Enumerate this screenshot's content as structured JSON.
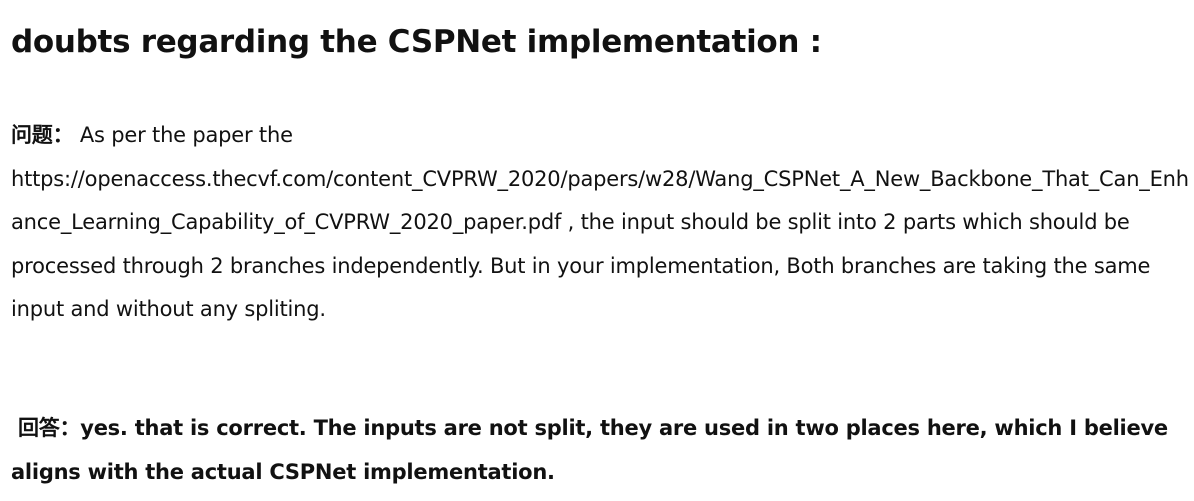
{
  "title": "doubts regarding the CSPNet implementation :",
  "question": {
    "label": "问题：",
    "text_before_link": "As per the paper the",
    "link": "https://openaccess.thecvf.com/content_CVPRW_2020/papers/w28/Wang_CSPNet_A_New_Backbone_That_Can_Enhance_Learning_Capability_of_CVPRW_2020_paper.pdf",
    "text_after_link": " , the input should be split into 2 parts which should be processed through 2 branches independently. But in your implementation, Both branches are taking the same input and without any spliting."
  },
  "answer": {
    "label": "回答：",
    "text": "yes. that is correct. The inputs are not split, they are used in two places here, which I believe aligns with the actual CSPNet implementation."
  }
}
